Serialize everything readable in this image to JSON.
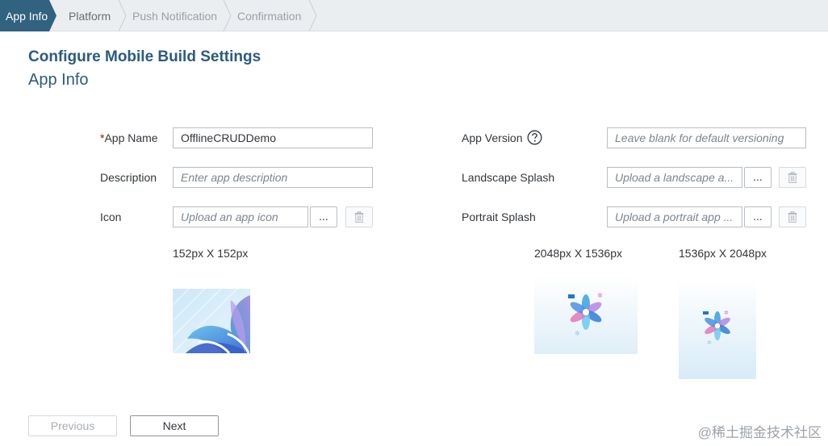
{
  "wizard": {
    "steps": [
      {
        "label": "App Info",
        "state": "active"
      },
      {
        "label": "Platform",
        "state": "enabled"
      },
      {
        "label": "Push Notification",
        "state": "disabled"
      },
      {
        "label": "Confirmation",
        "state": "disabled"
      }
    ]
  },
  "header": {
    "title": "Configure Mobile Build Settings",
    "subtitle": "App Info"
  },
  "form": {
    "app_name": {
      "required_mark": "*",
      "label": "App Name",
      "value": "OfflineCRUDDemo"
    },
    "description": {
      "label": "Description",
      "placeholder": "Enter app description"
    },
    "icon": {
      "label": "Icon",
      "placeholder": "Upload an app icon",
      "browse_label": "...",
      "dimensions": "152px X 152px"
    },
    "app_version": {
      "label": "App Version",
      "placeholder": "Leave blank for default versioning",
      "help_icon": "question-circle-icon"
    },
    "landscape_splash": {
      "label": "Landscape Splash",
      "placeholder": "Upload a landscape a...",
      "browse_label": "...",
      "dimensions": "2048px X 1536px"
    },
    "portrait_splash": {
      "label": "Portrait Splash",
      "placeholder": "Upload a portrait app ...",
      "browse_label": "...",
      "dimensions": "1536px X 2048px"
    }
  },
  "footer": {
    "previous_label": "Previous",
    "next_label": "Next"
  },
  "watermark": "@稀土掘金技术社区",
  "colors": {
    "accent": "#2a5b82",
    "active_step": "#31627f",
    "required": "#bb0000"
  }
}
